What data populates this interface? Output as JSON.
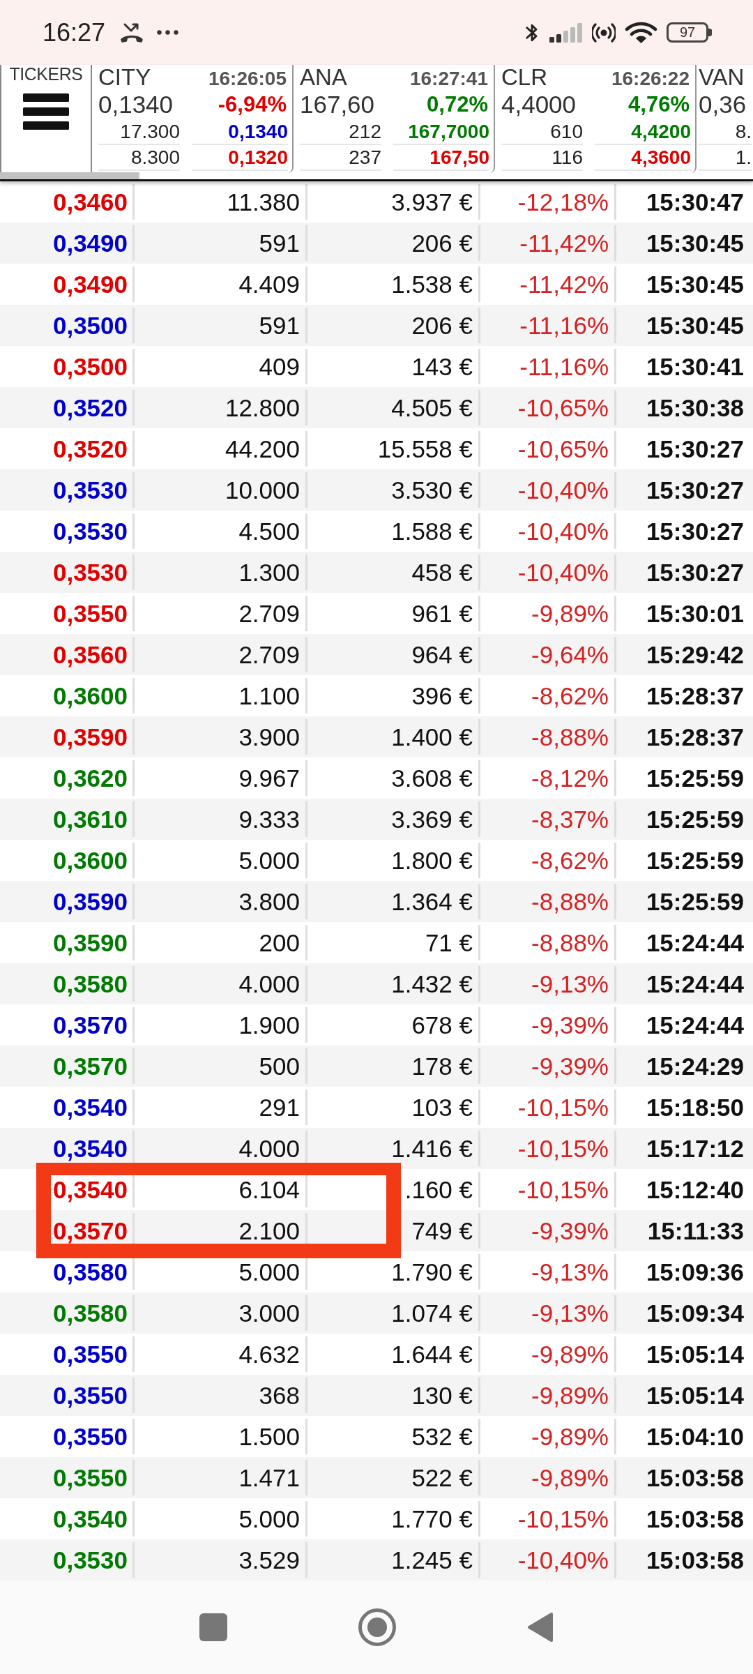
{
  "status_bar": {
    "time": "16:27",
    "battery": "97"
  },
  "tickers": {
    "label": "TICKERS",
    "cards": [
      {
        "name": "CITY",
        "time": "16:26:05",
        "last": "0,1340",
        "change": {
          "text": "-6,94%",
          "color": "#e00000"
        },
        "bid": {
          "volume": "17.300",
          "price": "0,1340",
          "color": "#0000cc"
        },
        "ask": {
          "volume": "8.300",
          "price": "0,1320",
          "color": "#e00000"
        }
      },
      {
        "name": "ANA",
        "time": "16:27:41",
        "last": "167,60",
        "change": {
          "text": "0,72%",
          "color": "#007a00"
        },
        "bid": {
          "volume": "212",
          "price": "167,7000",
          "color": "#007a00"
        },
        "ask": {
          "volume": "237",
          "price": "167,50",
          "color": "#e00000"
        }
      },
      {
        "name": "CLR",
        "time": "16:26:22",
        "last": "4,4000",
        "change": {
          "text": "4,76%",
          "color": "#007a00"
        },
        "bid": {
          "volume": "610",
          "price": "4,4200",
          "color": "#007a00"
        },
        "ask": {
          "volume": "116",
          "price": "4,3600",
          "color": "#e00000"
        }
      },
      {
        "name": "VAN",
        "last": "0,36",
        "bid": {
          "volume": "8."
        },
        "ask": {
          "volume": "1."
        }
      }
    ]
  },
  "trades": {
    "rows": [
      {
        "price": "0,3460",
        "color": "#e00000",
        "volume": "11.380",
        "amount": "3.937 €",
        "change": "-12,18%",
        "time": "15:30:47"
      },
      {
        "price": "0,3490",
        "color": "#0000cc",
        "volume": "591",
        "amount": "206 €",
        "change": "-11,42%",
        "time": "15:30:45"
      },
      {
        "price": "0,3490",
        "color": "#e00000",
        "volume": "4.409",
        "amount": "1.538 €",
        "change": "-11,42%",
        "time": "15:30:45"
      },
      {
        "price": "0,3500",
        "color": "#0000cc",
        "volume": "591",
        "amount": "206 €",
        "change": "-11,16%",
        "time": "15:30:45"
      },
      {
        "price": "0,3500",
        "color": "#e00000",
        "volume": "409",
        "amount": "143 €",
        "change": "-11,16%",
        "time": "15:30:41"
      },
      {
        "price": "0,3520",
        "color": "#0000cc",
        "volume": "12.800",
        "amount": "4.505 €",
        "change": "-10,65%",
        "time": "15:30:38"
      },
      {
        "price": "0,3520",
        "color": "#e00000",
        "volume": "44.200",
        "amount": "15.558 €",
        "change": "-10,65%",
        "time": "15:30:27"
      },
      {
        "price": "0,3530",
        "color": "#0000cc",
        "volume": "10.000",
        "amount": "3.530 €",
        "change": "-10,40%",
        "time": "15:30:27"
      },
      {
        "price": "0,3530",
        "color": "#0000cc",
        "volume": "4.500",
        "amount": "1.588 €",
        "change": "-10,40%",
        "time": "15:30:27"
      },
      {
        "price": "0,3530",
        "color": "#e00000",
        "volume": "1.300",
        "amount": "458 €",
        "change": "-10,40%",
        "time": "15:30:27"
      },
      {
        "price": "0,3550",
        "color": "#e00000",
        "volume": "2.709",
        "amount": "961 €",
        "change": "-9,89%",
        "time": "15:30:01"
      },
      {
        "price": "0,3560",
        "color": "#e00000",
        "volume": "2.709",
        "amount": "964 €",
        "change": "-9,64%",
        "time": "15:29:42"
      },
      {
        "price": "0,3600",
        "color": "#007a00",
        "volume": "1.100",
        "amount": "396 €",
        "change": "-8,62%",
        "time": "15:28:37"
      },
      {
        "price": "0,3590",
        "color": "#e00000",
        "volume": "3.900",
        "amount": "1.400 €",
        "change": "-8,88%",
        "time": "15:28:37"
      },
      {
        "price": "0,3620",
        "color": "#007a00",
        "volume": "9.967",
        "amount": "3.608 €",
        "change": "-8,12%",
        "time": "15:25:59"
      },
      {
        "price": "0,3610",
        "color": "#007a00",
        "volume": "9.333",
        "amount": "3.369 €",
        "change": "-8,37%",
        "time": "15:25:59"
      },
      {
        "price": "0,3600",
        "color": "#007a00",
        "volume": "5.000",
        "amount": "1.800 €",
        "change": "-8,62%",
        "time": "15:25:59"
      },
      {
        "price": "0,3590",
        "color": "#0000cc",
        "volume": "3.800",
        "amount": "1.364 €",
        "change": "-8,88%",
        "time": "15:25:59"
      },
      {
        "price": "0,3590",
        "color": "#007a00",
        "volume": "200",
        "amount": "71 €",
        "change": "-8,88%",
        "time": "15:24:44"
      },
      {
        "price": "0,3580",
        "color": "#007a00",
        "volume": "4.000",
        "amount": "1.432 €",
        "change": "-9,13%",
        "time": "15:24:44"
      },
      {
        "price": "0,3570",
        "color": "#0000cc",
        "volume": "1.900",
        "amount": "678 €",
        "change": "-9,39%",
        "time": "15:24:44"
      },
      {
        "price": "0,3570",
        "color": "#007a00",
        "volume": "500",
        "amount": "178 €",
        "change": "-9,39%",
        "time": "15:24:29"
      },
      {
        "price": "0,3540",
        "color": "#0000cc",
        "volume": "291",
        "amount": "103 €",
        "change": "-10,15%",
        "time": "15:18:50"
      },
      {
        "price": "0,3540",
        "color": "#0000cc",
        "volume": "4.000",
        "amount": "1.416 €",
        "change": "-10,15%",
        "time": "15:17:12"
      },
      {
        "price": "0,3540",
        "color": "#e00000",
        "volume": "6.104",
        "amount": ".160 €",
        "change": "-10,15%",
        "time": "15:12:40"
      },
      {
        "price": "0,3570",
        "color": "#e00000",
        "volume": "2.100",
        "amount": "749 €",
        "change": "-9,39%",
        "time": "15:11:33"
      },
      {
        "price": "0,3580",
        "color": "#0000cc",
        "volume": "5.000",
        "amount": "1.790 €",
        "change": "-9,13%",
        "time": "15:09:36"
      },
      {
        "price": "0,3580",
        "color": "#007a00",
        "volume": "3.000",
        "amount": "1.074 €",
        "change": "-9,13%",
        "time": "15:09:34"
      },
      {
        "price": "0,3550",
        "color": "#0000cc",
        "volume": "4.632",
        "amount": "1.644 €",
        "change": "-9,89%",
        "time": "15:05:14"
      },
      {
        "price": "0,3550",
        "color": "#0000cc",
        "volume": "368",
        "amount": "130 €",
        "change": "-9,89%",
        "time": "15:05:14"
      },
      {
        "price": "0,3550",
        "color": "#0000cc",
        "volume": "1.500",
        "amount": "532 €",
        "change": "-9,89%",
        "time": "15:04:10"
      },
      {
        "price": "0,3550",
        "color": "#007a00",
        "volume": "1.471",
        "amount": "522 €",
        "change": "-9,89%",
        "time": "15:03:58"
      },
      {
        "price": "0,3540",
        "color": "#007a00",
        "volume": "5.000",
        "amount": "1.770 €",
        "change": "-10,15%",
        "time": "15:03:58"
      },
      {
        "price": "0,3530",
        "color": "#007a00",
        "volume": "3.529",
        "amount": "1.245 €",
        "change": "-10,40%",
        "time": "15:03:58"
      }
    ]
  }
}
